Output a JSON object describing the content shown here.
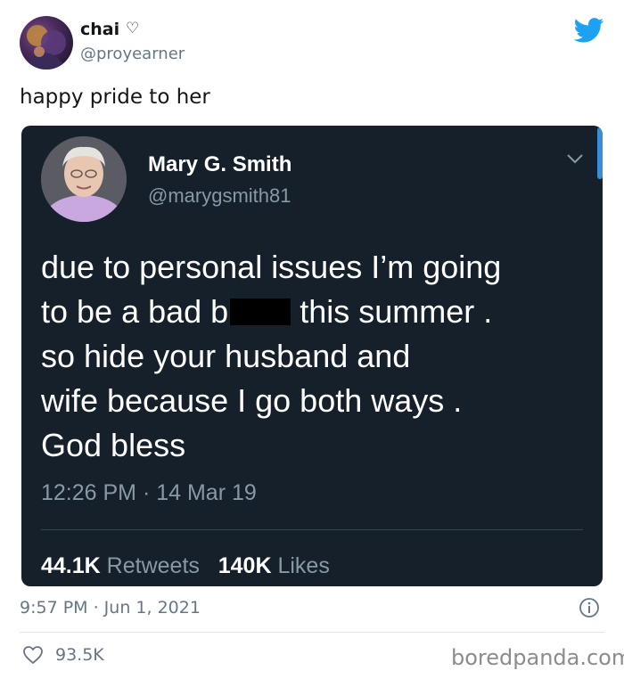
{
  "outer_tweet": {
    "name": "chai",
    "name_icon": "heart-outline-icon",
    "handle": "@proyearner",
    "text": "happy pride to her",
    "timestamp": "9:57 PM · Jun 1, 2021",
    "like_count": "93.5K",
    "brand_icon": "twitter-bird-icon",
    "brand_color": "#1da1f2"
  },
  "embedded_tweet": {
    "name": "Mary G. Smith",
    "handle": "@marygsmith81",
    "text_lines": [
      "due to personal issues I’m going",
      "to be a bad b",
      "this summer .",
      "so hide your husband and",
      "wife because I go both ways .",
      "God bless"
    ],
    "timestamp": "12:26 PM · 14 Mar 19",
    "retweets_count": "44.1K",
    "retweets_label": "Retweets",
    "likes_count": "140K",
    "likes_label": "Likes",
    "background_color": "#15202b"
  },
  "watermark": "boredpanda.com"
}
